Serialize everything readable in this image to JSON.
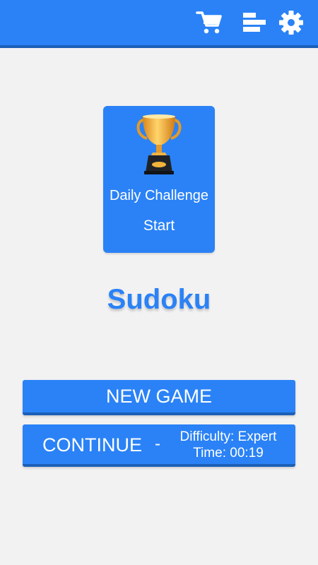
{
  "topbar": {
    "icons": [
      "cart-icon",
      "stats-icon",
      "gear-icon"
    ],
    "accent_color": "#2a82f6"
  },
  "daily_challenge": {
    "title": "Daily Challenge",
    "action": "Start",
    "icon": "trophy-icon"
  },
  "app": {
    "title": "Sudoku"
  },
  "buttons": {
    "new_game": "NEW GAME",
    "continue": "CONTINUE",
    "separator": "-",
    "difficulty": "Difficulty: Expert",
    "time": "Time: 00:19"
  }
}
